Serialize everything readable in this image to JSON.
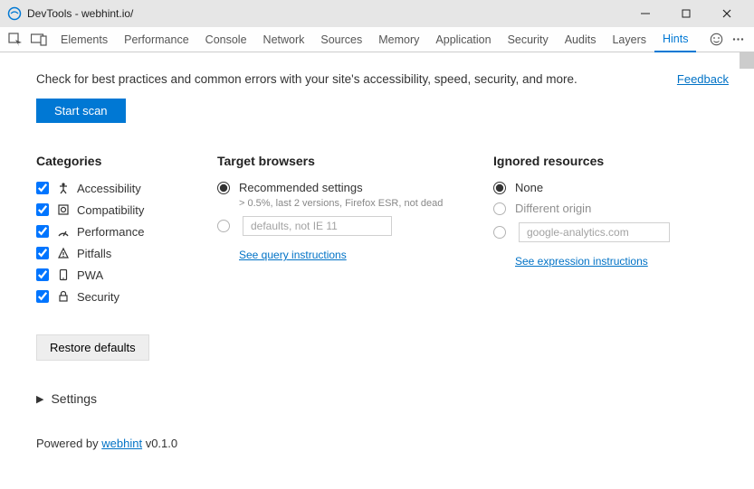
{
  "window": {
    "title": "DevTools - webhint.io/"
  },
  "tabs": {
    "items": [
      "Elements",
      "Performance",
      "Console",
      "Network",
      "Sources",
      "Memory",
      "Application",
      "Security",
      "Audits",
      "Layers",
      "Hints"
    ],
    "active_index": 10
  },
  "intro": "Check for best practices and common errors with your site's accessibility, speed, security, and more.",
  "feedback_label": "Feedback",
  "start_scan_label": "Start scan",
  "categories": {
    "heading": "Categories",
    "items": [
      {
        "label": "Accessibility",
        "checked": true
      },
      {
        "label": "Compatibility",
        "checked": true
      },
      {
        "label": "Performance",
        "checked": true
      },
      {
        "label": "Pitfalls",
        "checked": true
      },
      {
        "label": "PWA",
        "checked": true
      },
      {
        "label": "Security",
        "checked": true
      }
    ]
  },
  "target_browsers": {
    "heading": "Target browsers",
    "recommended_label": "Recommended settings",
    "recommended_sub": "> 0.5%, last 2 versions, Firefox ESR, not dead",
    "custom_input_value": "defaults, not IE 11",
    "query_link": "See query instructions",
    "selected": "recommended"
  },
  "ignored": {
    "heading": "Ignored resources",
    "none_label": "None",
    "diff_origin_label": "Different origin",
    "custom_input_value": "google-analytics.com",
    "expr_link": "See expression instructions",
    "selected": "none"
  },
  "restore_label": "Restore defaults",
  "settings_label": "Settings",
  "footer": {
    "prefix": "Powered by ",
    "link_text": "webhint",
    "version": " v0.1.0"
  }
}
